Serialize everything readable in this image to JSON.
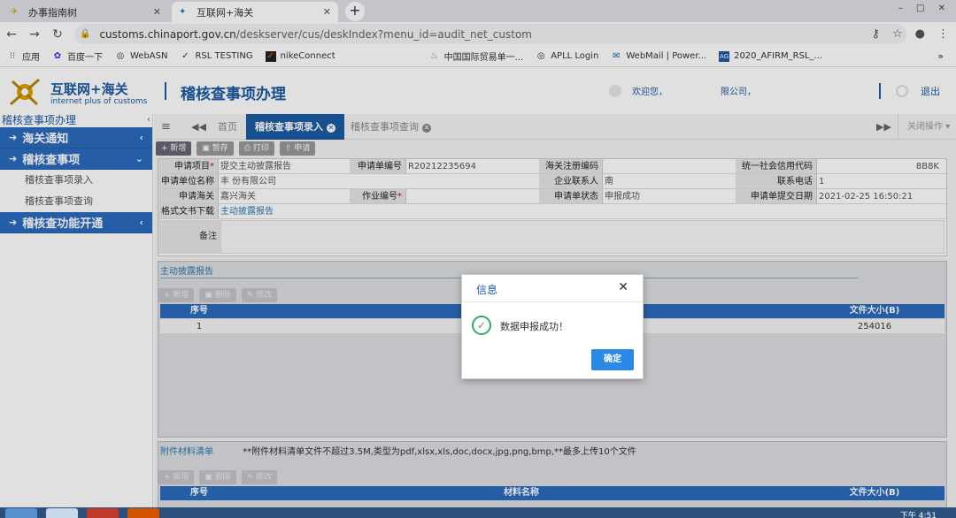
{
  "browser": {
    "tabs": [
      {
        "label": "办事指南树",
        "icon": "pin-icon"
      },
      {
        "label": "互联网+海关",
        "icon": "customs-icon"
      }
    ],
    "new_tab": "+",
    "window_controls": "–  □  ✕",
    "url_host": "customs.chinaport.gov.cn",
    "url_path": "/deskserver/cus/deskIndex?menu_id=audit_net_custom",
    "bookmarks": [
      {
        "label": "应用",
        "icon": "apps-icon"
      },
      {
        "label": "百度一下",
        "icon": "baidu-icon"
      },
      {
        "label": "WebASN",
        "icon": "globe-icon"
      },
      {
        "label": "RSL TESTING",
        "icon": "swoosh-icon"
      },
      {
        "label": "nikeConnect",
        "icon": "nike-icon"
      },
      {
        "label": "中国国际贸易单一...",
        "icon": "flame-icon"
      },
      {
        "label": "APLL Login",
        "icon": "globe-icon"
      },
      {
        "label": "WebMail | Power...",
        "icon": "mail-icon"
      },
      {
        "label": "2020_AFIRM_RSL_...",
        "icon": "ag-icon"
      }
    ],
    "bookmarks_more": "»"
  },
  "header": {
    "logo_cn": "互联网+海关",
    "logo_en": "internet plus of customs",
    "title": "稽核查事项办理",
    "welcome": "欢迎您，",
    "company": "限公司，",
    "exit": "退出"
  },
  "sidebar": {
    "heading": "稽核查事项办理",
    "collapse": "‹",
    "items": [
      {
        "label": "海关通知",
        "arrow": "‹"
      },
      {
        "label": "稽核查事项",
        "arrow": "⌄"
      },
      {
        "label": "稽核查功能开通",
        "arrow": "‹"
      }
    ],
    "subitems": [
      "稽核查事项录入",
      "稽核查事项查询"
    ]
  },
  "content_tabs": {
    "home": "首页",
    "active": "稽核查事项录入",
    "query": "稽核查事项查询",
    "close_ops": "关闭操作"
  },
  "toolbar": {
    "add": "+ 新增",
    "save": "▣ 暂存",
    "print": "⎙ 打印",
    "submit": "⇧ 申请"
  },
  "form": {
    "row1": {
      "l1": "申请项目",
      "v1": "提交主动披露报告",
      "l2": "申请单编号",
      "v2": "R20212235694",
      "l3": "海关注册编码",
      "v3": "",
      "l4": "统一社会信用代码",
      "v4": "8B8K"
    },
    "row2": {
      "l1": "申请单位名称",
      "v1": "丰                    份有限公司",
      "l2": "",
      "v2": "",
      "l3": "企业联系人",
      "v3": "南",
      "l4": "联系电话",
      "v4": "1"
    },
    "row3": {
      "l1": "申请海关",
      "v1": "嘉兴海关",
      "l2": "作业编号",
      "v2": "",
      "l3": "申请单状态",
      "v3": "申报成功",
      "l4": "申请单提交日期",
      "v4": "2021-02-25 16:50:21"
    },
    "row4": {
      "l1": "格式文书下载",
      "v1": "主动披露报告"
    },
    "remark_label": "备注"
  },
  "panel1": {
    "title": "主动披露报告",
    "tools": [
      "+ 新增",
      "▣ 删除",
      "✎ 修改"
    ],
    "columns": [
      "序号",
      "",
      "文件大小(B)"
    ],
    "rows": [
      [
        "1",
        "",
        "254016"
      ]
    ]
  },
  "panel2": {
    "title": "附件材料清单",
    "note": "**附件材料清单文件不超过3.5M,类型为pdf,xlsx,xls,doc,docx,jpg,png,bmp,**最多上传10个文件",
    "tools": [
      "+ 新增",
      "▣ 删除",
      "✎ 修改"
    ],
    "columns": [
      "序号",
      "材料名称",
      "文件大小(B)"
    ]
  },
  "dialog": {
    "title": "信息",
    "close": "✕",
    "message": "数据申报成功！",
    "confirm": "确定"
  },
  "taskbar": {
    "time": "下午 4:51"
  },
  "colors": {
    "brand": "#1c5aa3",
    "sidebar_blue": "#2b6cbe",
    "confirm_button": "#2b8ae6",
    "success": "#3aa865"
  }
}
